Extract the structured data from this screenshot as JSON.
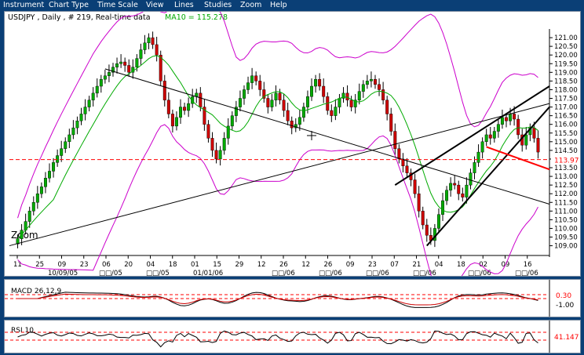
{
  "menu": [
    "Instrument",
    "Chart Type",
    "Time Scale",
    "View",
    "Lines",
    "Studies",
    "Zoom",
    "Help"
  ],
  "header": {
    "symbol_info": "USDJPY , Daily , # 219, Real-time data",
    "ma_label": "MA10 = 115.278"
  },
  "zoom_label": "Zoom",
  "colors": {
    "background": "#0a3f76",
    "up_candle": "#00aa00",
    "down_candle": "#cc0000",
    "ma_line": "#00aa00",
    "bollinger": "#cc00cc",
    "support_line": "#ff0000",
    "trendline": "#000000",
    "current_price_label": "#ff0000"
  },
  "chart_data": {
    "type": "candlestick",
    "ylim": [
      108.8,
      121.5
    ],
    "yticks": [
      109.0,
      109.5,
      110.0,
      110.5,
      111.0,
      111.5,
      112.0,
      112.5,
      113.0,
      113.5,
      114.0,
      114.5,
      115.0,
      115.5,
      116.0,
      116.5,
      117.0,
      117.5,
      118.0,
      118.5,
      119.0,
      119.5,
      120.0,
      120.5,
      121.0
    ],
    "current_price": "113.97",
    "day_ticks": [
      "11",
      "25",
      "09",
      "23",
      "06",
      "20",
      "04",
      "18",
      "01",
      "15",
      "29",
      "12",
      "26",
      "12",
      "26",
      "09",
      "23",
      "07",
      "21",
      "04",
      "18",
      "02",
      "09",
      "16"
    ],
    "month_labels": [
      "10/09/05",
      "□□/05",
      "□□/05",
      "01/01/06",
      "□□/06",
      "□□/06",
      "□□/06",
      "□□/06",
      "□□/06",
      "□□/06"
    ],
    "closes": [
      109.4,
      109.9,
      110.4,
      111.0,
      111.5,
      112.0,
      112.4,
      112.9,
      113.3,
      113.8,
      114.2,
      114.6,
      115.0,
      115.4,
      115.8,
      116.2,
      116.6,
      117.0,
      117.4,
      117.8,
      118.2,
      118.6,
      118.8,
      119.0,
      119.3,
      119.5,
      119.6,
      119.4,
      119.0,
      119.3,
      119.8,
      120.3,
      120.7,
      121.0,
      120.6,
      120.0,
      118.5,
      117.4,
      116.6,
      115.9,
      116.4,
      117.0,
      116.8,
      117.2,
      117.6,
      117.8,
      117.0,
      116.0,
      115.2,
      114.5,
      114.0,
      114.5,
      115.2,
      115.9,
      116.5,
      117.0,
      117.5,
      118.0,
      118.4,
      118.8,
      118.5,
      118.0,
      117.5,
      117.0,
      117.4,
      117.8,
      117.4,
      116.8,
      116.2,
      115.8,
      116.0,
      116.4,
      117.0,
      117.6,
      118.2,
      118.6,
      118.2,
      117.6,
      116.8,
      116.5,
      117.0,
      117.5,
      117.8,
      117.4,
      117.0,
      117.4,
      117.9,
      118.3,
      118.5,
      118.6,
      118.3,
      118.0,
      117.4,
      116.6,
      115.6,
      114.6,
      114.0,
      113.6,
      113.2,
      112.8,
      112.0,
      111.0,
      110.2,
      109.6,
      109.3,
      110.0,
      110.8,
      111.6,
      112.2,
      112.6,
      112.5,
      112.0,
      111.8,
      112.5,
      113.2,
      113.8,
      114.4,
      115.0,
      115.4,
      115.2,
      115.6,
      116.0,
      116.4,
      116.2,
      116.6,
      116.3,
      115.4,
      114.8,
      115.4,
      115.8,
      115.2,
      114.4
    ],
    "ma10_current": "115.278",
    "macd": {
      "label": "MACD 26,12,9",
      "yticks": [
        "0.30",
        "-1.00"
      ]
    },
    "rsi": {
      "label": "RSI 10",
      "value": "41.147"
    }
  }
}
